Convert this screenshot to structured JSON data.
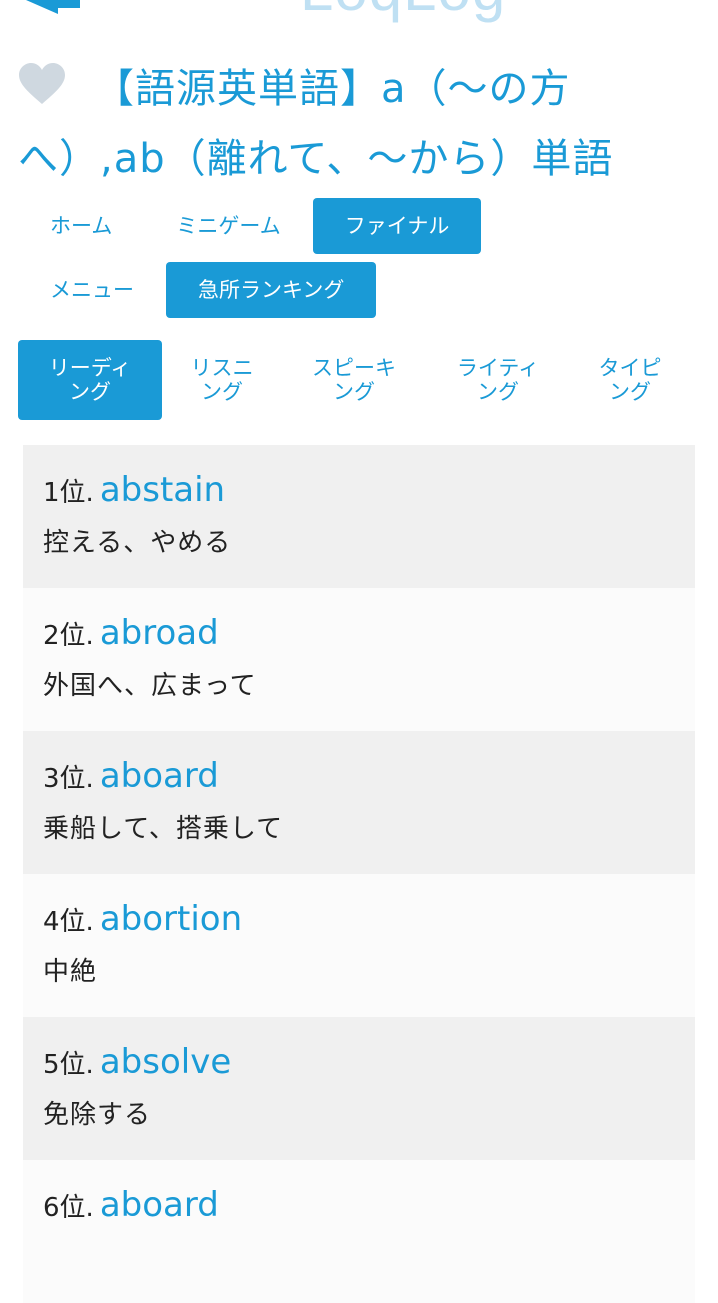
{
  "header": {
    "logo_text": "LoqLog"
  },
  "title": "【語源英単語】a（〜の方へ）,ab（離れて、〜から）単語",
  "nav": {
    "items": [
      {
        "label": "ホーム"
      },
      {
        "label": "ミニゲーム"
      },
      {
        "label": "ファイナル",
        "active": true
      },
      {
        "label": "メニュー"
      },
      {
        "label": "急所ランキング",
        "active": true
      }
    ]
  },
  "tabs": [
    {
      "label": "リーディング",
      "active": true
    },
    {
      "label": "リスニング"
    },
    {
      "label": "スピーキング"
    },
    {
      "label": "ライティング"
    },
    {
      "label": "タイピング"
    }
  ],
  "ranking": [
    {
      "rank": "1位.",
      "word": "abstain",
      "meaning": "控える、やめる"
    },
    {
      "rank": "2位.",
      "word": "abroad",
      "meaning": "外国へ、広まって"
    },
    {
      "rank": "3位.",
      "word": "aboard",
      "meaning": "乗船して、搭乗して"
    },
    {
      "rank": "4位.",
      "word": "abortion",
      "meaning": "中絶"
    },
    {
      "rank": "5位.",
      "word": "absolve",
      "meaning": "免除する"
    },
    {
      "rank": "6位.",
      "word": "aboard",
      "meaning": ""
    }
  ],
  "colors": {
    "accent": "#1a9ad6",
    "row_odd": "#f0f0f0",
    "row_even": "#fbfbfb",
    "heart": "#cfd8e0"
  }
}
